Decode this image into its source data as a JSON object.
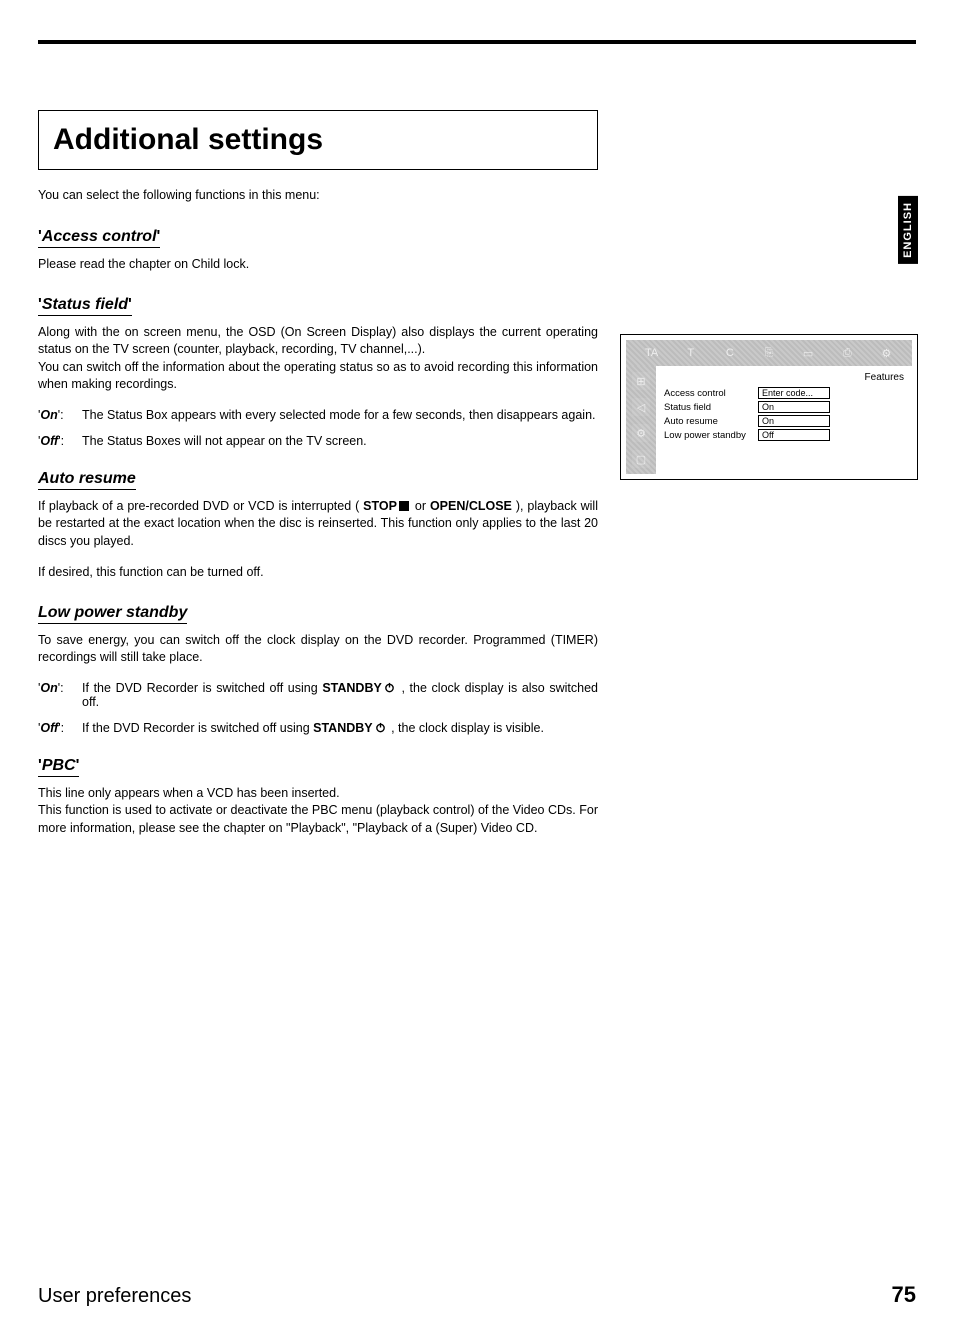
{
  "side_tab": "ENGLISH",
  "title": "Additional settings",
  "intro": "You can select the following functions in this menu:",
  "sections": {
    "access": {
      "heading_inner": "Access control",
      "body": "Please read the chapter on Child lock."
    },
    "status": {
      "heading_inner": "Status field",
      "p1": "Along with the on screen menu, the OSD (On Screen Display) also displays the current operating status on the TV screen (counter, playback, recording, TV channel,...).",
      "p2": "You can switch off the information about the operating status so as to avoid recording this information when making recordings.",
      "on_label": "On",
      "on_text": "The Status Box appears with every selected mode for a few seconds, then disappears again.",
      "off_label": "Off",
      "off_text": "The Status Boxes will not appear on the TV screen."
    },
    "auto": {
      "heading": "Auto resume",
      "p1a": "If playback of a pre-recorded DVD or VCD is interrupted ( ",
      "stop": "STOP",
      "p1b": " or ",
      "open": "OPEN/CLOSE",
      "p1c": " ), playback will be restarted at the exact location when the disc is reinserted. This function only applies to the last 20 discs you played.",
      "p2": "If desired, this function can be turned off."
    },
    "low": {
      "heading": "Low power standby",
      "p1": "To save energy, you can switch off the clock display on the DVD recorder. Programmed (TIMER) recordings will still take place.",
      "on_label": "On",
      "on_a": "If the DVD Recorder is switched off using ",
      "standby": "STANDBY",
      "on_b": " , the clock display is also switched off.",
      "off_label": "Off",
      "off_a": "If the DVD Recorder is switched off using ",
      "off_b": " , the clock display is visible."
    },
    "pbc": {
      "heading_inner": "PBC",
      "p1": "This line only appears when a VCD has been inserted.",
      "p2": "This function is used to activate or deactivate the PBC menu (playback control) of the Video CDs. For more information, please see the chapter on \"Playback\", \"Playback of a (Super) Video CD."
    }
  },
  "osd": {
    "panel_title": "Features",
    "top_icons": [
      "TA",
      "T",
      "C",
      "⎘",
      "▭",
      "⎙",
      "⚙"
    ],
    "side_icons": [
      "⊞",
      "◁",
      "⚙",
      "▢"
    ],
    "rows": [
      {
        "label": "Access control",
        "value": "Enter code..."
      },
      {
        "label": "Status field",
        "value": "On"
      },
      {
        "label": "Auto resume",
        "value": "On"
      },
      {
        "label": "Low power standby",
        "value": "Off"
      }
    ]
  },
  "footer": {
    "title": "User preferences",
    "page": "75"
  }
}
